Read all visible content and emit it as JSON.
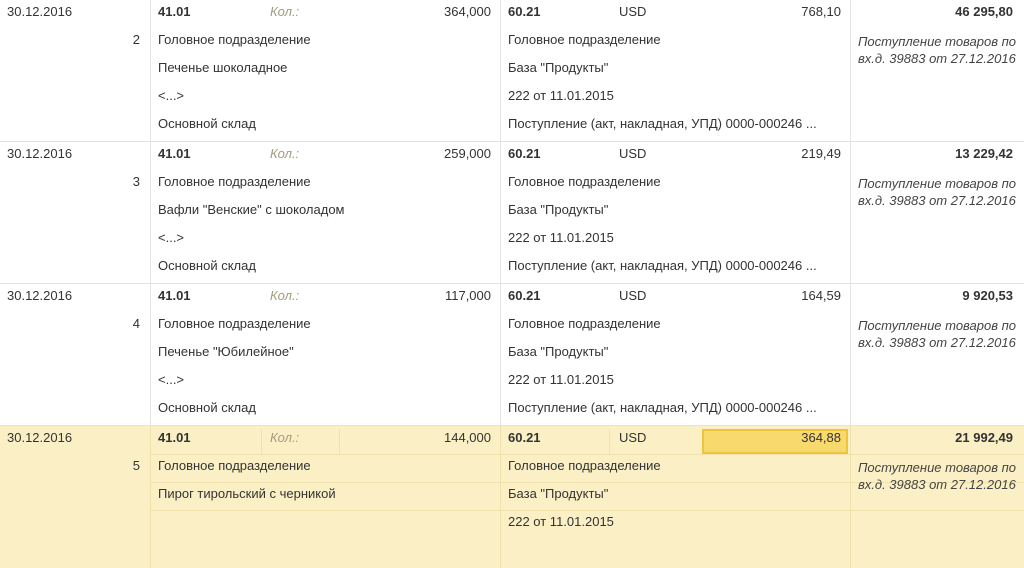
{
  "entries": [
    {
      "date": "30.12.2016",
      "number": "2",
      "debit_account": "41.01",
      "qty_label": "Кол.:",
      "quantity": "364,000",
      "debit_subconto": [
        "Головное подразделение",
        "Печенье шоколадное",
        "<...>",
        "Основной склад"
      ],
      "credit_account": "60.21",
      "currency": "USD",
      "currency_amount": "768,10",
      "amount": "46 295,80",
      "credit_subconto": [
        "Головное подразделение",
        "База \"Продукты\"",
        "222 от 11.01.2015",
        "Поступление (акт, накладная, УПД) 0000-000246 ..."
      ],
      "content": "Поступление товаров по вх.д. 39883 от 27.12.2016"
    },
    {
      "date": "30.12.2016",
      "number": "3",
      "debit_account": "41.01",
      "qty_label": "Кол.:",
      "quantity": "259,000",
      "debit_subconto": [
        "Головное подразделение",
        "Вафли \"Венские\" с шоколадом",
        "<...>",
        "Основной склад"
      ],
      "credit_account": "60.21",
      "currency": "USD",
      "currency_amount": "219,49",
      "amount": "13 229,42",
      "credit_subconto": [
        "Головное подразделение",
        "База \"Продукты\"",
        "222 от 11.01.2015",
        "Поступление (акт, накладная, УПД) 0000-000246 ..."
      ],
      "content": "Поступление товаров по вх.д. 39883 от 27.12.2016"
    },
    {
      "date": "30.12.2016",
      "number": "4",
      "debit_account": "41.01",
      "qty_label": "Кол.:",
      "quantity": "117,000",
      "debit_subconto": [
        "Головное подразделение",
        "Печенье \"Юбилейное\"",
        "<...>",
        "Основной склад"
      ],
      "credit_account": "60.21",
      "currency": "USD",
      "currency_amount": "164,59",
      "amount": "9 920,53",
      "credit_subconto": [
        "Головное подразделение",
        "База \"Продукты\"",
        "222 от 11.01.2015",
        "Поступление (акт, накладная, УПД) 0000-000246 ..."
      ],
      "content": "Поступление товаров по вх.д. 39883 от 27.12.2016"
    },
    {
      "date": "30.12.2016",
      "number": "5",
      "debit_account": "41.01",
      "qty_label": "Кол.:",
      "quantity": "144,000",
      "debit_subconto": [
        "Головное подразделение",
        "Пирог тирольский с черникой",
        "",
        ""
      ],
      "credit_account": "60.21",
      "currency": "USD",
      "currency_amount": "364,88",
      "amount": "21 992,49",
      "credit_subconto": [
        "Головное подразделение",
        "База \"Продукты\"",
        "222 от 11.01.2015",
        ""
      ],
      "content": "Поступление товаров по вх.д. 39883 от 27.12.2016"
    }
  ],
  "colors": {
    "selected_row": "#fbf0c5",
    "active_cell": "#f8d96e",
    "label": "#a59a80"
  }
}
